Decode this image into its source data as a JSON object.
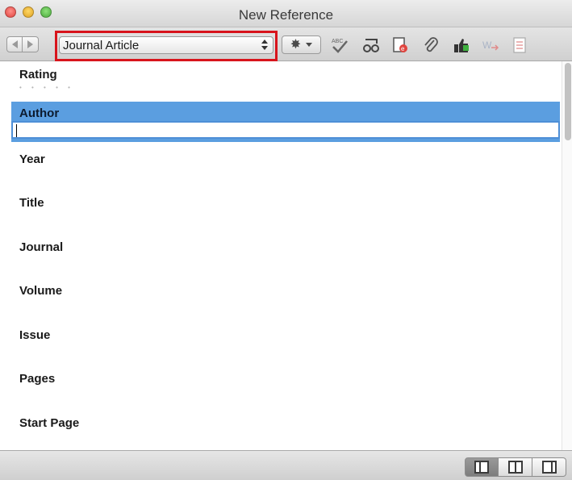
{
  "window": {
    "title": "New Reference"
  },
  "toolbar": {
    "reference_type": "Journal Article",
    "icons": [
      "back-arrow-icon",
      "forward-arrow-icon",
      "gear-icon",
      "spell-check-icon",
      "find-full-text-icon",
      "open-url-icon",
      "attach-file-icon",
      "thumbs-up-icon",
      "word-icon",
      "notes-list-icon"
    ],
    "highlight_color": "#d8141c"
  },
  "fields": {
    "rating": {
      "label": "Rating"
    },
    "author": {
      "label": "Author",
      "value": ""
    },
    "year": {
      "label": "Year"
    },
    "title": {
      "label": "Title"
    },
    "journal": {
      "label": "Journal"
    },
    "volume": {
      "label": "Volume"
    },
    "issue": {
      "label": "Issue"
    },
    "pages": {
      "label": "Pages"
    },
    "start_page": {
      "label": "Start Page"
    }
  },
  "colors": {
    "selected_field_background": "#5b9ee0"
  },
  "bottombar": {
    "layouts": [
      "layout-left-pane-icon",
      "layout-middle-pane-icon",
      "layout-right-pane-icon"
    ],
    "active_layout": 0
  }
}
